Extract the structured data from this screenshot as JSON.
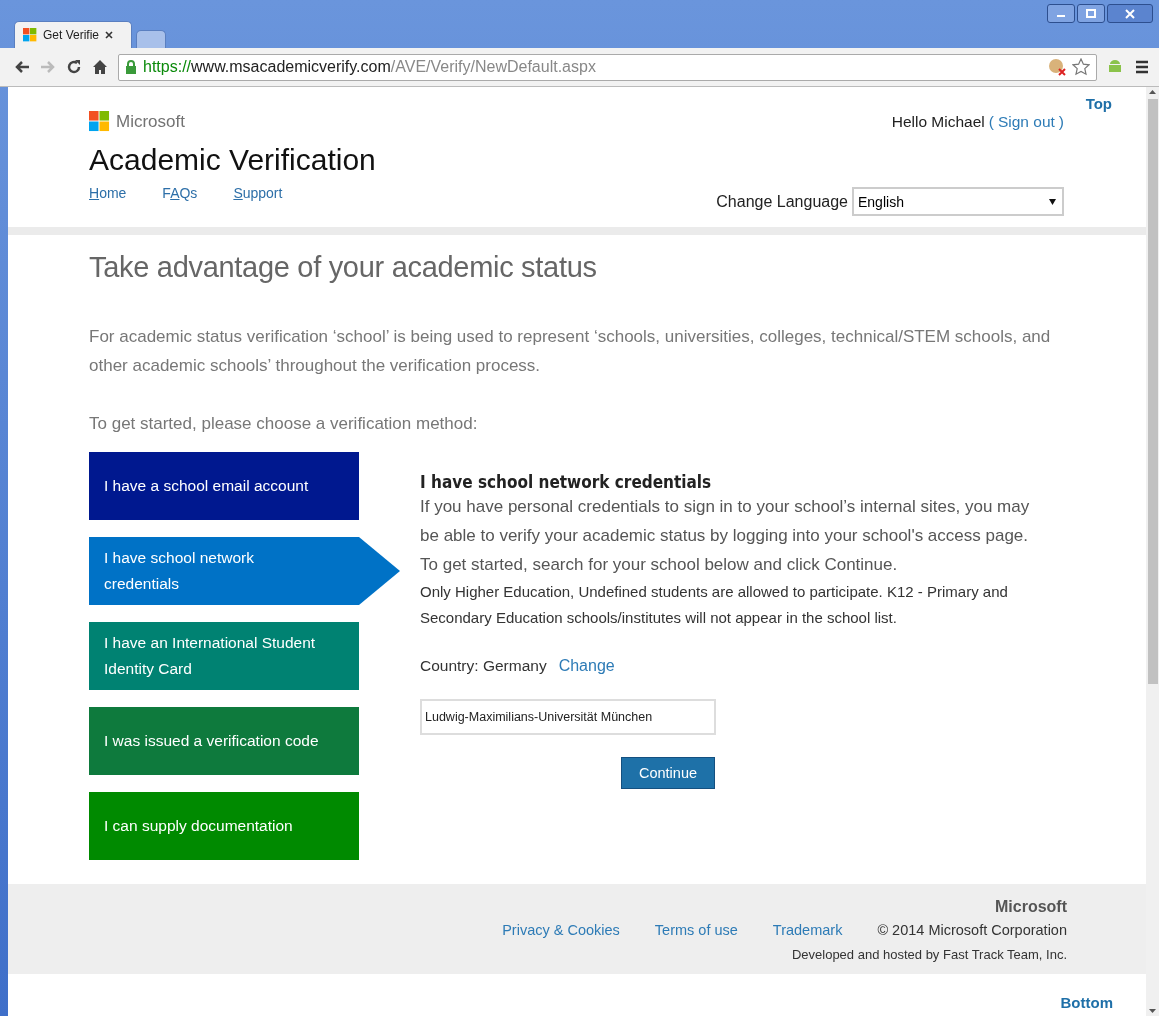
{
  "browser": {
    "tabs": [
      {
        "title": "Get Verifie",
        "selected": true
      },
      {
        "selected": false
      }
    ],
    "url": {
      "scheme": "https://",
      "host": "www.msacademicverify.com",
      "path": "/AVE/Verify/NewDefault.aspx"
    }
  },
  "header": {
    "logo": "Microsoft",
    "title": "Academic Verification",
    "greeting": "Hello Michael",
    "open_paren": "(",
    "sign_out": "Sign out",
    "close_paren": ")",
    "top_link": "Top",
    "nav": [
      {
        "key": "H",
        "after": "ome"
      },
      {
        "before": "F",
        "key": "A",
        "after": "Qs"
      },
      {
        "key": "S",
        "after": "upport"
      }
    ],
    "language": {
      "label": "Change Language",
      "value": "English"
    }
  },
  "main": {
    "heading": "Take advantage of your academic status",
    "intro": "For academic status verification ‘school’ is being used to represent ‘schools, universities, colleges, technical/STEM schools, and other academic schools’ throughout the verification process.",
    "prompt": "To get started, please choose a verification method:",
    "methods": [
      {
        "label": "I have a school email account",
        "color": "#00188f",
        "selected": false
      },
      {
        "label": "I have school network credentials",
        "color": "#0072c6",
        "selected": true
      },
      {
        "label": "I have an International Student Identity Card",
        "color": "#008272",
        "selected": false
      },
      {
        "label": "I was issued a verification code",
        "color": "#0e7a3d",
        "selected": false
      },
      {
        "label": "I can supply documentation",
        "color": "#008a00",
        "selected": false
      }
    ],
    "detail": {
      "title": "I have school network credentials",
      "description": "If you have personal credentials to sign in to your school’s internal sites, you may be able to verify your academic status by logging into your school's access page. To get started, search for your school below and click Continue.",
      "note": "Only Higher Education, Undefined students are allowed to participate. K12 - Primary and Secondary Education schools/institutes will not appear in the school list.",
      "country": "Country: Germany",
      "change_link": "Change",
      "school": "Ludwig-Maximilians-Universität München",
      "button": "Continue"
    }
  },
  "footer": {
    "brand": "Microsoft",
    "links": [
      "Privacy & Cookies",
      "Terms of use",
      "Trademark"
    ],
    "copyright": "© 2014 Microsoft Corporation",
    "developer": "Developed and hosted by Fast Track Team, Inc.",
    "bottom_link": "Bottom"
  }
}
